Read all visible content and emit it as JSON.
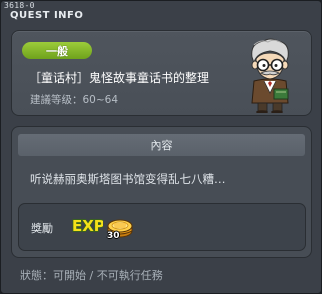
{
  "window": {
    "id_tag": "3618-0",
    "title": "QUEST INFO"
  },
  "quest": {
    "type_badge": "一般",
    "title": "［童话村］鬼怪故事童话书的整理",
    "level": "建議等级：60~64",
    "npc_icon": "librarian-npc-portrait"
  },
  "content": {
    "header": "內容",
    "description": "听说赫丽奥斯塔图书馆变得乱七八糟…",
    "reward": {
      "label": "獎勵",
      "exp_icon": "exp-icon",
      "meso_icon": "meso-icon",
      "meso_count": "30"
    }
  },
  "status": {
    "label": "狀態：",
    "value": "可開始 / 不可執行任務"
  },
  "colors": {
    "badge_green": "#86b82b",
    "exp_yellow": "#f5e11a",
    "meso_gold": "#f0b21c"
  }
}
